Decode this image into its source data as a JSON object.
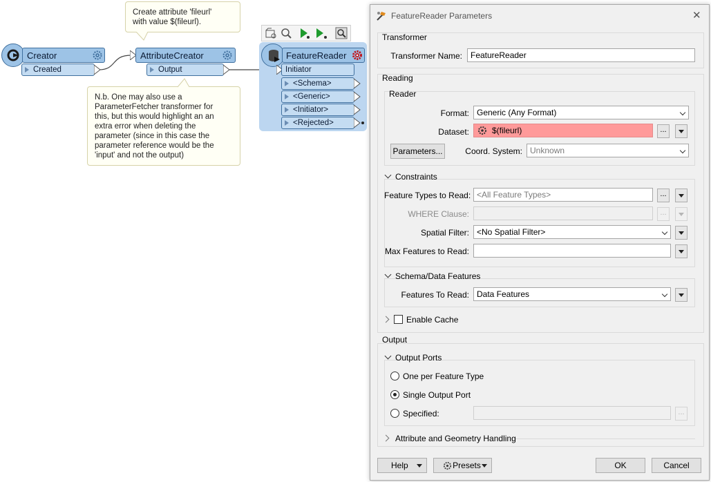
{
  "canvas": {
    "creator": {
      "title": "Creator",
      "port": "Created"
    },
    "attribute_creator": {
      "title": "AttributeCreator",
      "port": "Output"
    },
    "feature_reader": {
      "title": "FeatureReader",
      "input_port": "Initiator",
      "output_ports": [
        "<Schema>",
        "<Generic>",
        "<Initiator>",
        "<Rejected>"
      ]
    },
    "note_top": "Create attribute 'fileurl'\nwith value $(fileurl).",
    "note_bottom": "N.b. One may also use a\nParameterFetcher transformer for\nthis, but this would highlight an an\nextra error when deleting the\nparameter (since in this case the\nparameter reference would be the\n'input' and not the output)"
  },
  "dialog": {
    "title": "FeatureReader Parameters",
    "close": "✕",
    "transformer_section": "Transformer",
    "transformer_name_label": "Transformer Name:",
    "transformer_name_value": "FeatureReader",
    "reading_section": "Reading",
    "reader_section": "Reader",
    "format_label": "Format:",
    "format_value": "Generic (Any Format)",
    "dataset_label": "Dataset:",
    "dataset_value": "$(fileurl)",
    "ellipsis": "...",
    "parameters_button": "Parameters...",
    "coord_label": "Coord. System:",
    "coord_value": "Unknown",
    "constraints_section": "Constraints",
    "feature_types_label": "Feature Types to Read:",
    "feature_types_value": "<All Feature Types>",
    "where_label": "WHERE Clause:",
    "spatial_filter_label": "Spatial Filter:",
    "spatial_filter_value": "<No Spatial Filter>",
    "max_features_label": "Max Features to Read:",
    "schema_section": "Schema/Data Features",
    "features_to_read_label": "Features To Read:",
    "features_to_read_value": "Data Features",
    "enable_cache_label": "Enable Cache",
    "output_section": "Output",
    "output_ports_section": "Output Ports",
    "radio_one_per": "One per Feature Type",
    "radio_single": "Single Output Port",
    "radio_specified": "Specified:",
    "attr_geom_section": "Attribute and Geometry Handling",
    "help_button": "Help",
    "presets_button": "Presets",
    "ok_button": "OK",
    "cancel_button": "Cancel"
  },
  "colors": {
    "node_fill": "#9dc3e6",
    "selected_bg": "#bcd6f0",
    "dataset_error": "#ff9a9a",
    "gear_red": "#c0141c"
  }
}
